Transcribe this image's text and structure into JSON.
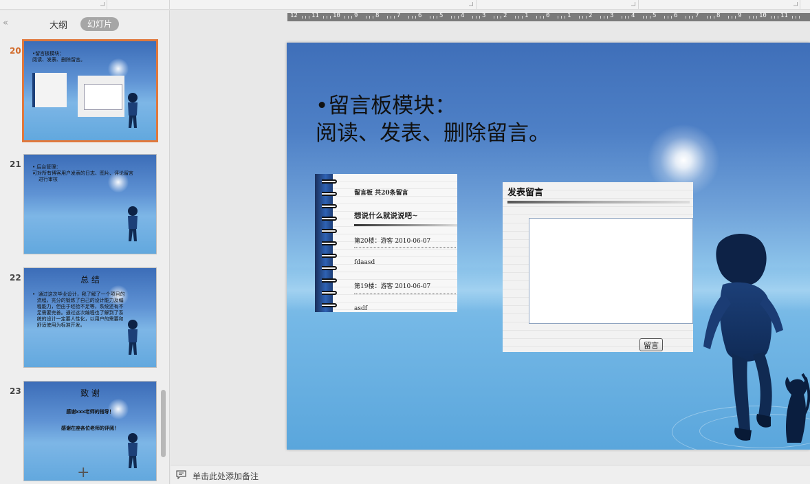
{
  "panel": {
    "tabs": {
      "outline": "大纲",
      "slides": "幻灯片"
    }
  },
  "thumbnails": [
    {
      "number": "20",
      "active": true,
      "title": "",
      "lines": [
        "•留言板模块：",
        "阅读、发表、删除留言。"
      ]
    },
    {
      "number": "21",
      "active": false,
      "title": "",
      "lines": [
        "• 后台管理：",
        "可对所有博客用户发表的日志、图片、评论留言",
        "    进行审核"
      ]
    },
    {
      "number": "22",
      "active": false,
      "title": "总 结",
      "lines": [
        "•  通过这次毕业设计，我了解了一个项目的",
        "   流程，充分的锻炼了自己的设计能力及编",
        "   程能力，但由于经验不足等，系统还有不",
        "   足需要完善。通过这次编程也了解到了系",
        "   统的设计一定要人性化，以用户的需要和",
        "   舒适使用为标准开发。"
      ]
    },
    {
      "number": "23",
      "active": false,
      "title": "致 谢",
      "lines": [
        "感谢xxx老师的指导！",
        "感谢在座各位老师的评阅！"
      ]
    }
  ],
  "ruler": {
    "labels": [
      "12",
      "11",
      "10",
      "9",
      "8",
      "7",
      "6",
      "5",
      "4",
      "3",
      "2",
      "1",
      "0",
      "1",
      "2",
      "3",
      "4",
      "5",
      "6",
      "7",
      "8",
      "9",
      "10",
      "11"
    ]
  },
  "slide": {
    "title_line1": "•留言板模块：",
    "title_line2": "阅读、发表、删除留言。",
    "board": {
      "header": "留言板  共20条留言",
      "prompt": "想说什么就说说吧~",
      "entries": [
        {
          "meta": "第20楼：游客  2010-06-07",
          "text": "fdaasd"
        },
        {
          "meta": "第19楼：游客  2010-06-07",
          "text": "asdf"
        }
      ]
    },
    "post": {
      "title": "发表留言",
      "button": "留言",
      "textarea_value": ""
    }
  },
  "notes": {
    "placeholder": "单击此处添加备注"
  },
  "colors": {
    "active_accent": "#e0783c",
    "slide_blue": "#4e80c6"
  },
  "icons": {
    "collapse": "double-chevron-left-icon",
    "add": "plus-icon",
    "notes": "comment-icon"
  }
}
